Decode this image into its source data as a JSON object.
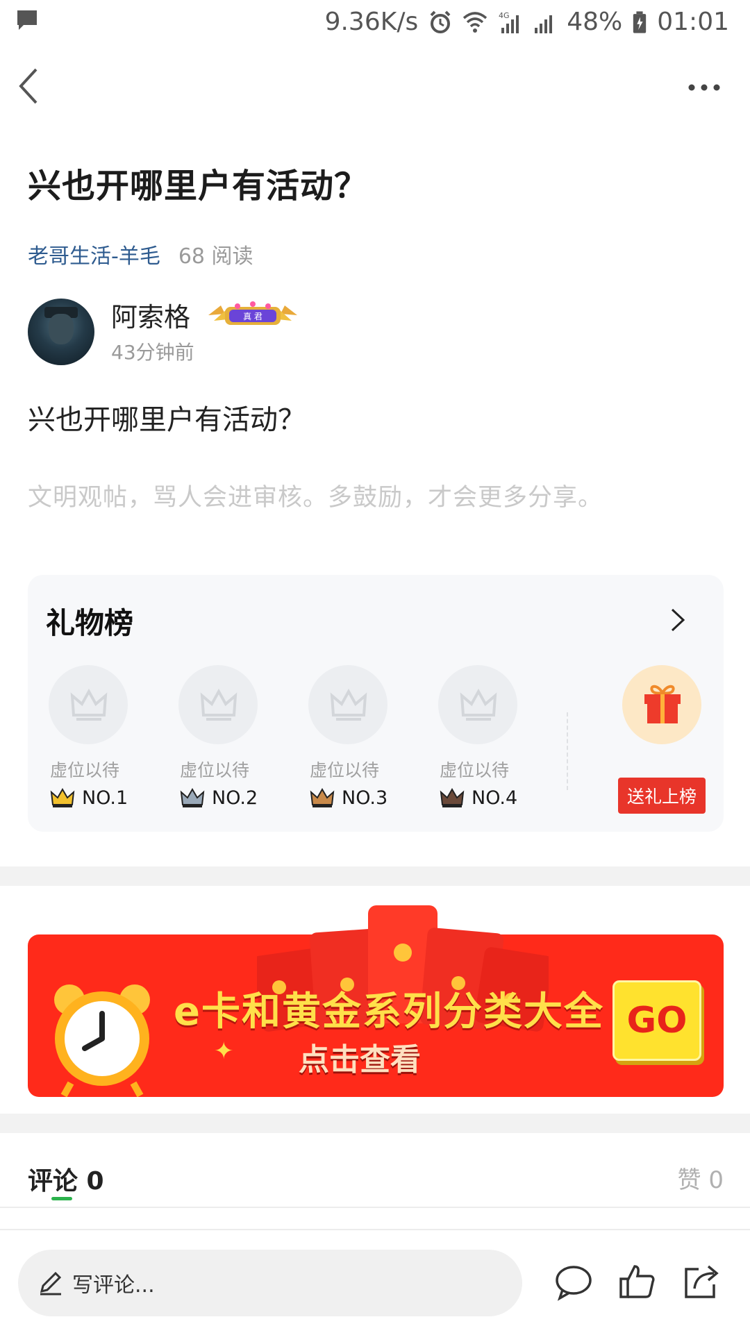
{
  "status_bar": {
    "speed": "9.36K/s",
    "battery": "48%",
    "time": "01:01",
    "icons": [
      "message-icon",
      "alarm-icon",
      "wifi-icon",
      "4g-signal-icon",
      "signal-icon",
      "battery-icon"
    ]
  },
  "nav": {
    "back_icon": "back-arrow-icon",
    "more_icon": "more-dots-icon"
  },
  "post": {
    "title": "兴也开哪里户有活动？",
    "channel": "老哥生活-羊毛",
    "reads": "68 阅读",
    "author": {
      "name": "阿索格",
      "badge_text": "真 君",
      "time": "43分钟前"
    },
    "body": "兴也开哪里户有活动？",
    "notice": "文明观帖，骂人会进审核。多鼓励，才会更多分享。"
  },
  "gift_board": {
    "title": "礼物榜",
    "slots": [
      {
        "label": "虚位以待",
        "rank": "NO.1",
        "crown_color": "#f2c12e"
      },
      {
        "label": "虚位以待",
        "rank": "NO.2",
        "crown_color": "#9aa9b8"
      },
      {
        "label": "虚位以待",
        "rank": "NO.3",
        "crown_color": "#c98a4a"
      },
      {
        "label": "虚位以待",
        "rank": "NO.4",
        "crown_color": "#6b4a3a"
      }
    ],
    "send_button": "送礼上榜"
  },
  "banner": {
    "main_text": "e卡和黄金系列分类大全",
    "sub_text": "点击查看",
    "go_text": "GO"
  },
  "comments": {
    "label": "评论 0",
    "likes": "赞 0"
  },
  "bottom_bar": {
    "input_placeholder": "写评论..."
  },
  "colors": {
    "accent_red": "#e8352a",
    "channel_blue": "#2e5b8f",
    "tab_green": "#2bb24c"
  }
}
